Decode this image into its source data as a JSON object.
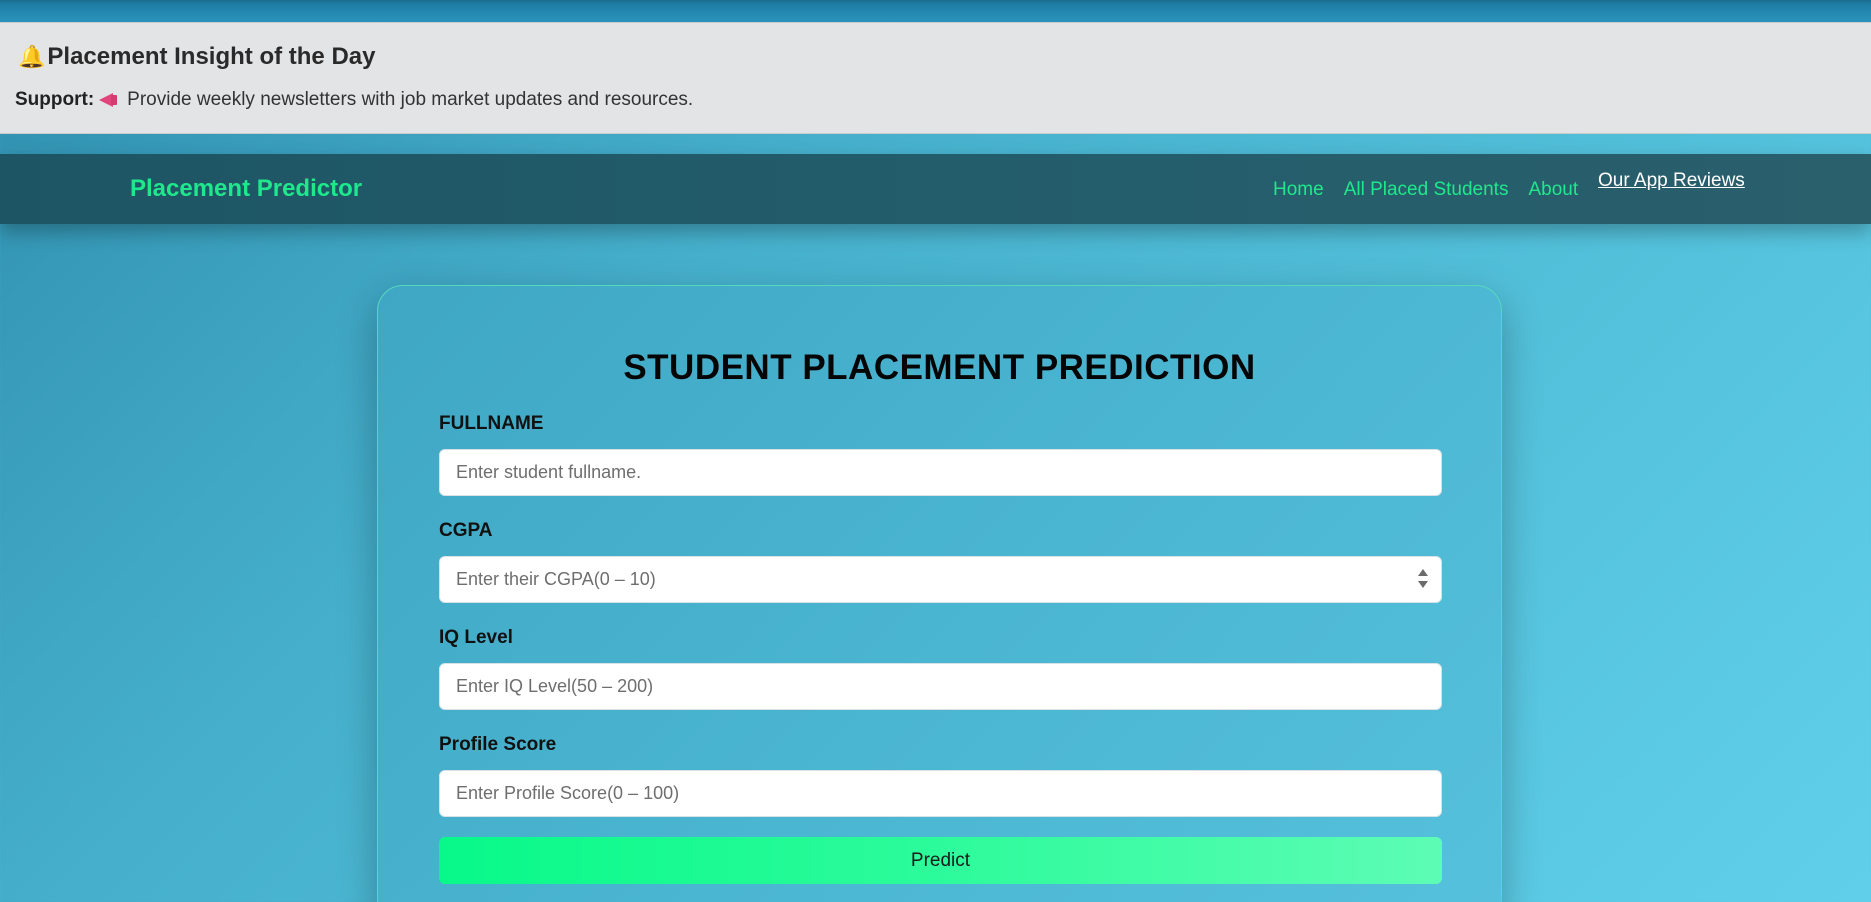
{
  "insight": {
    "title": "Placement Insight of the Day",
    "support_label": "Support:",
    "support_text": "Provide weekly newsletters with job market updates and resources.",
    "title_icon": "bell-icon",
    "support_icon": "megaphone-icon"
  },
  "navbar": {
    "brand": "Placement Predictor",
    "links": [
      {
        "label": "Home"
      },
      {
        "label": "All Placed Students"
      },
      {
        "label": "About"
      }
    ],
    "reviews_link": "Our App Reviews"
  },
  "form": {
    "title": "STUDENT PLACEMENT PREDICTION",
    "fields": [
      {
        "label": "FULLNAME",
        "placeholder": "Enter student fullname.",
        "value": ""
      },
      {
        "label": "CGPA",
        "placeholder": "Enter their CGPA(0 – 10)",
        "value": ""
      },
      {
        "label": "IQ Level",
        "placeholder": "Enter IQ Level(50 – 200)",
        "value": ""
      },
      {
        "label": "Profile Score",
        "placeholder": "Enter Profile Score(0 – 100)",
        "value": ""
      }
    ],
    "submit_label": "Predict"
  },
  "colors": {
    "accent": "#1fe88c",
    "button_start": "#08f98a",
    "button_end": "#5dfcb5",
    "navbar": "#1d5565",
    "insight_bg": "#e3e4e6"
  }
}
